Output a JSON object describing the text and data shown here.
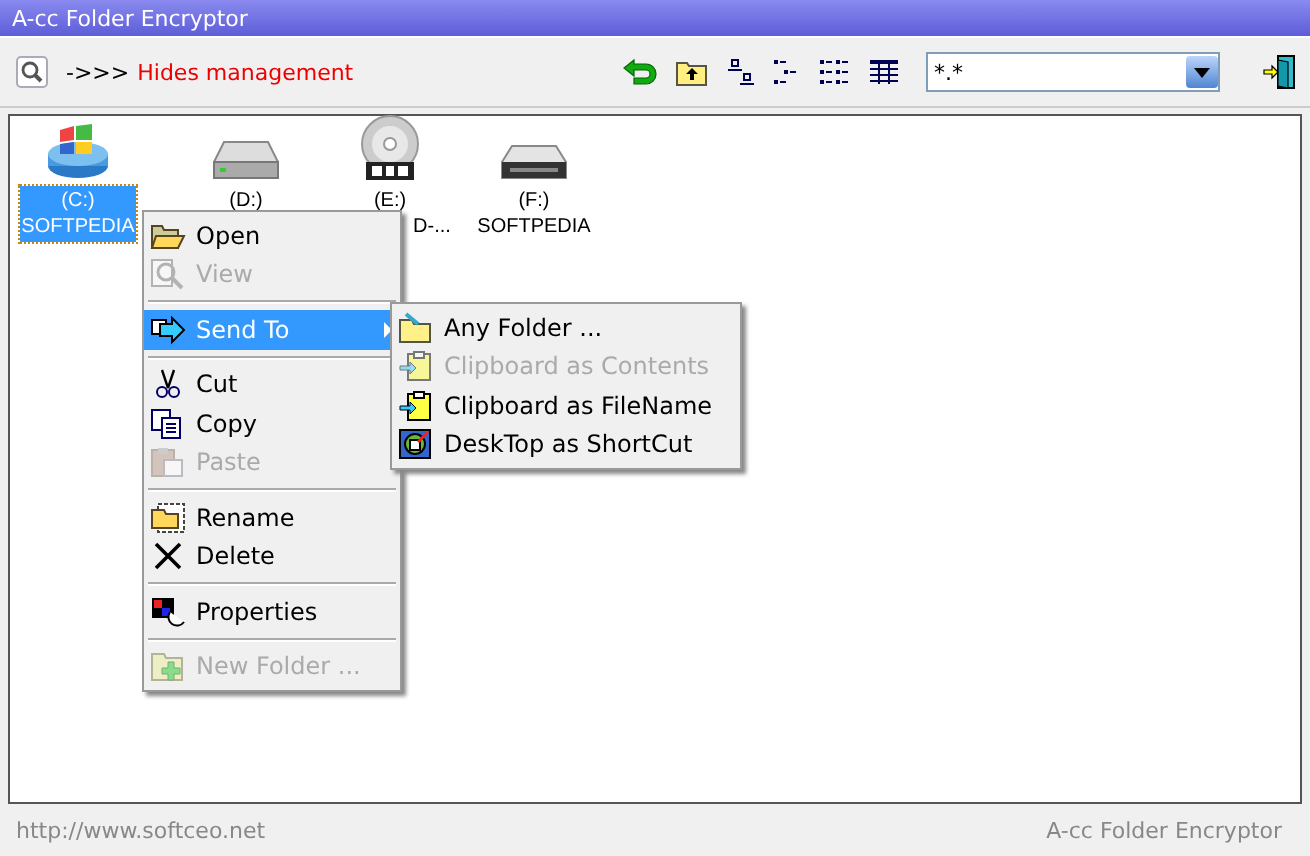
{
  "window": {
    "title": "A-cc Folder Encryptor"
  },
  "toolbar": {
    "arrows": "->>>",
    "mode_label": "Hides management",
    "filter": {
      "value": "*.*"
    }
  },
  "drives": [
    {
      "name": "(C:)",
      "label": "SOFTPEDIA",
      "selected": true,
      "kind": "system"
    },
    {
      "name": "(D:)",
      "selected": false,
      "kind": "disk"
    },
    {
      "name": "(E:)",
      "label": "D-...",
      "selected": false,
      "kind": "dvd"
    },
    {
      "name": "(F:)",
      "label": "SOFTPEDIA",
      "selected": false,
      "kind": "removable"
    }
  ],
  "context_menu": {
    "items": [
      {
        "kind": "item",
        "label": "Open",
        "disabled": false,
        "selected": false
      },
      {
        "kind": "item",
        "label": "View",
        "disabled": true,
        "selected": false
      },
      {
        "kind": "separator"
      },
      {
        "kind": "submenu",
        "label": "Send To",
        "disabled": false,
        "selected": true,
        "expanded": true
      },
      {
        "kind": "separator"
      },
      {
        "kind": "item",
        "label": "Cut",
        "disabled": false,
        "selected": false
      },
      {
        "kind": "item",
        "label": "Copy",
        "disabled": false,
        "selected": false
      },
      {
        "kind": "item",
        "label": "Paste",
        "disabled": true,
        "selected": false
      },
      {
        "kind": "separator"
      },
      {
        "kind": "item",
        "label": "Rename",
        "disabled": false,
        "selected": false
      },
      {
        "kind": "item",
        "label": "Delete",
        "disabled": false,
        "selected": false
      },
      {
        "kind": "separator"
      },
      {
        "kind": "item",
        "label": "Properties",
        "disabled": false,
        "selected": false
      },
      {
        "kind": "separator"
      },
      {
        "kind": "item",
        "label": "New Folder ...",
        "disabled": true,
        "selected": false
      }
    ]
  },
  "submenu": {
    "items": [
      {
        "label": "Any Folder ...",
        "disabled": false
      },
      {
        "label": "Clipboard as Contents",
        "disabled": true
      },
      {
        "label": "Clipboard as FileName",
        "disabled": false
      },
      {
        "label": "DeskTop as ShortCut",
        "disabled": false
      }
    ]
  },
  "status_bar": {
    "left": "http://www.softceo.net",
    "right": "A-cc Folder Encryptor"
  }
}
